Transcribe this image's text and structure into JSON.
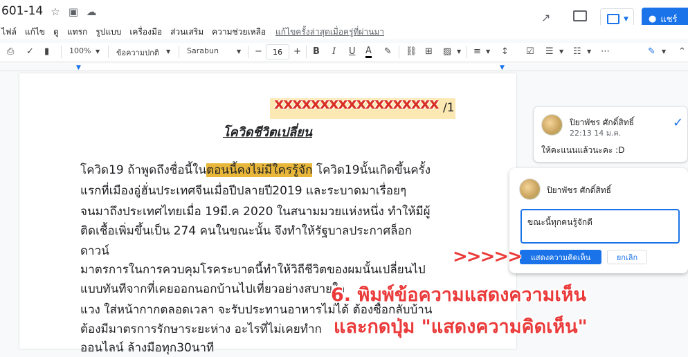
{
  "window": {
    "doc_title": "601-14",
    "icons": [
      "star-icon",
      "folder-move-icon",
      "cloud-icon"
    ]
  },
  "menu": {
    "items": [
      "ไฟล์",
      "แก้ไข",
      "ดู",
      "แทรก",
      "รูปแบบ",
      "เครื่องมือ",
      "ส่วนเสริม",
      "ความช่วยเหลือ"
    ],
    "last_edit": "แก้ไขครั้งล่าสุดเมื่อครู่ที่ผ่านมา"
  },
  "header_actions": {
    "share_label": "แชร์"
  },
  "toolbar": {
    "zoom": "100%",
    "style": "ข้อความปกติ",
    "font": "Sarabun",
    "font_size": "16",
    "minus": "−",
    "plus": "+",
    "bold": "B",
    "italic": "I",
    "underline": "U",
    "text_color": "A",
    "more": "⋯"
  },
  "document": {
    "redacted_line": "xxxxxxxxxxxxxxxxxx",
    "page_marker": "/1",
    "heading": "โควิดชีวิตเปลี่ยน",
    "lines": [
      {
        "pre": "   โควิด19 ถ้าพูดถึงชื่อนี้ใน",
        "hl": "ตอนนี้คงไม่มีใครรู้จัก",
        "post": " โควิด19นั้นเกิดขึ้นครั้ง"
      },
      {
        "pre": "แรกที่เมืองอู่ฮั่นประเทศจีนเมื่อปีปลายปี2019 และระบาดมาเรื่อยๆ",
        "hl": "",
        "post": ""
      },
      {
        "pre": "จนมาถึงประเทศไทยเมื่อ 19มี.ค 2020 ในสนามมวยแห่งหนึ่ง ทำให้มีผู้",
        "hl": "",
        "post": ""
      },
      {
        "pre": "ติดเชื้อเพิ่มขึ้นเป็น 274 คนในขณะนั้น จึงทำให้รัฐบาลประกาศล็อก",
        "hl": "",
        "post": ""
      },
      {
        "pre": "ดาวน์",
        "hl": "",
        "post": ""
      },
      {
        "pre": "  มาตรการในการควบคุมโรคระบาดนี้ทำให้วิถีชีวิตของผมนั้นเปลี่ยนไป",
        "hl": "",
        "post": ""
      },
      {
        "pre": "แบบทันทีจากที่เคยออกนอกบ้านไปเที่ยวอย่างสบายใจ",
        "hl": "",
        "post": ""
      },
      {
        "pre": "แวง ใส่หน้ากากตลอดเวลา จะรับประทานอาหารไม่ได้ ต้องซื้อกลับบ้าน",
        "hl": "",
        "post": ""
      },
      {
        "pre": "ต้องมีมาตรการรักษาระยะห่าง อะไรที่ไม่เคยทำก",
        "hl": "",
        "post": ""
      },
      {
        "pre": "ออนไลน์ ล้างมือทุก30นาที",
        "hl": "",
        "post": ""
      }
    ]
  },
  "comment_existing": {
    "author": "ปิยาพัชร ศักดิ์สิทธิ์",
    "time": "22:13 14 ม.ค.",
    "body": "ให้คะแนนแล้วนะคะ :D"
  },
  "comment_reply": {
    "author": "ปิยาพัชร ศักดิ์สิทธิ์",
    "input_value": "ขณะนี้ทุกคนรู้จักดี",
    "submit_label": "แสดงความคิดเห็น",
    "cancel_label": "ยกเลิก"
  },
  "overlay": {
    "arrows": ">>>>>",
    "instruction_line1": "6. พิมพ์ข้อความแสดงความเห็น",
    "instruction_line2": "และกดปุ่ม \"แสดงความคิดเห็น\""
  },
  "colors": {
    "accent": "#1a73e8",
    "highlight": "#e8b73a",
    "annotation": "#ea3a3a"
  }
}
